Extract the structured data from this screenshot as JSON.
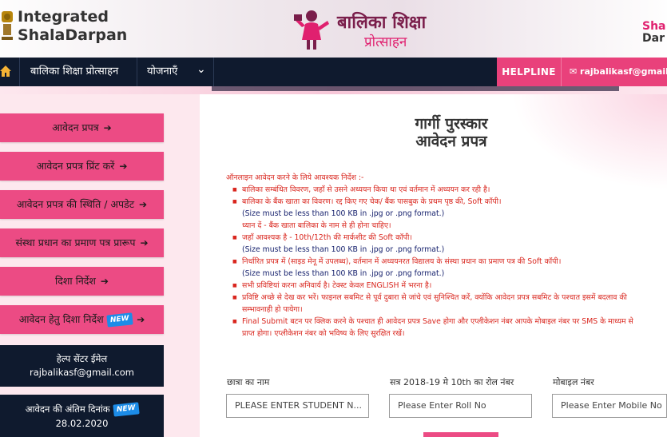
{
  "header": {
    "logo_line1": "Integrated",
    "logo_line2_a": "Shala",
    "logo_line2_b": "Darpan",
    "center_title": "बालिका शिक्षा",
    "center_subtitle": "प्रोत्साहन",
    "right_logo_a": "Sha",
    "right_logo_b": "Dar"
  },
  "nav": {
    "item1": "बालिका शिक्षा प्रोत्साहन",
    "item2": "योजनाएँ",
    "chevron": "⌄",
    "helpline": "HELPLINE",
    "email": "rajbalikasf@gmail.com"
  },
  "sidebar": {
    "items": [
      {
        "label": "आवेदन प्रपत्र"
      },
      {
        "label": "आवेदन प्रपत्र प्रिंट करें"
      },
      {
        "label": "आवेदन प्रपत्र की स्थिति / अपडेट"
      },
      {
        "label": "संस्था प्रधान का प्रमाण पत्र प्रारूप"
      },
      {
        "label": "दिशा निर्देश"
      },
      {
        "label": "आवेदन हेतु दिशा निर्देश"
      }
    ],
    "arrow": "➔",
    "new_badge": "NEW",
    "help_title": "हेल्प सेंटर ईमेल",
    "help_email": "rajbalikasf@gmail.com",
    "deadline_title": "आवेदन की अंतिम दिनांक",
    "deadline_date": "28.02.2020"
  },
  "main": {
    "title_line1": "गार्गी पुरस्कार",
    "title_line2": "आवेदन प्रपत्र",
    "instructions_heading": "ऑनलाइन आवेदन करने के लिये आवश्यक निर्देश :-",
    "size_note": "(Size must be less than 100 KB in .jpg or .png format.)",
    "instructions": {
      "i1": "बालिका सम्बंधित विवरण, जहाँ से उसने अध्ययन किया था एवं वर्तमान में अध्ययन कर रही है।",
      "i2": "बालिका के बैंक खाता का विवरण। रद्द किए गए चेक/ बैंक पासबुक के प्रथम पृष्ठ की, Soft कॉपी।",
      "i2_note": "ध्यान दें - बैंक खाता बालिका के नाम से ही होना चाहिए।",
      "i3": "जहाँ आवश्यक है - 10th/12th की मार्कशीट की Soft कॉपी।",
      "i4": "निर्धारित प्रपत्र में (साइड मेनू में उपलब्ध), वर्तमान में अध्ययनरत विद्यालय के संस्था प्रधान का प्रमाण पत्र की Soft कॉपी।",
      "i5": "सभी प्रविष्टियां करना अनिवार्य है। टेक्स्ट केवल ENGLISH में भरना है।",
      "i6a": "प्रविष्टि अच्छे से देख कर भरें। फाइनल सबमिट से पूर्व दुबारा से जांचे एवं सुनिश्चित करें, क्योंकि आवेदन प्रपत्र सबमिट के पश्चात इसमें बदलाव की",
      "i6b": "सम्भावनाही हो पायेगा।",
      "i7a": "Final Submit बटन पर क्लिक करने के पश्चात ही आवेदन प्रपत्र Save होगा और एप्लीकेशन नंबर आपके मोबाइल नंबर पर SMS के माध्यम से",
      "i7b": "प्राप्त होगा। एप्लीकेशन नंबर को भविष्य के लिए सुरक्षित रखें।"
    },
    "fields": {
      "name_label": "छात्रा का नाम",
      "name_placeholder": "PLEASE ENTER STUDENT N...",
      "roll_label": "सत्र 2018-19 मे 10th का रोल नंबर",
      "roll_placeholder": "Please Enter Roll No",
      "mobile_label": "मोबाइल नंबर",
      "mobile_placeholder": "Please Enter Mobile No"
    }
  },
  "colors": {
    "nav_bg": "#0f1a2e",
    "pink": "#ec4b84",
    "instruction_red": "#d9251d",
    "size_blue": "#16216d"
  }
}
